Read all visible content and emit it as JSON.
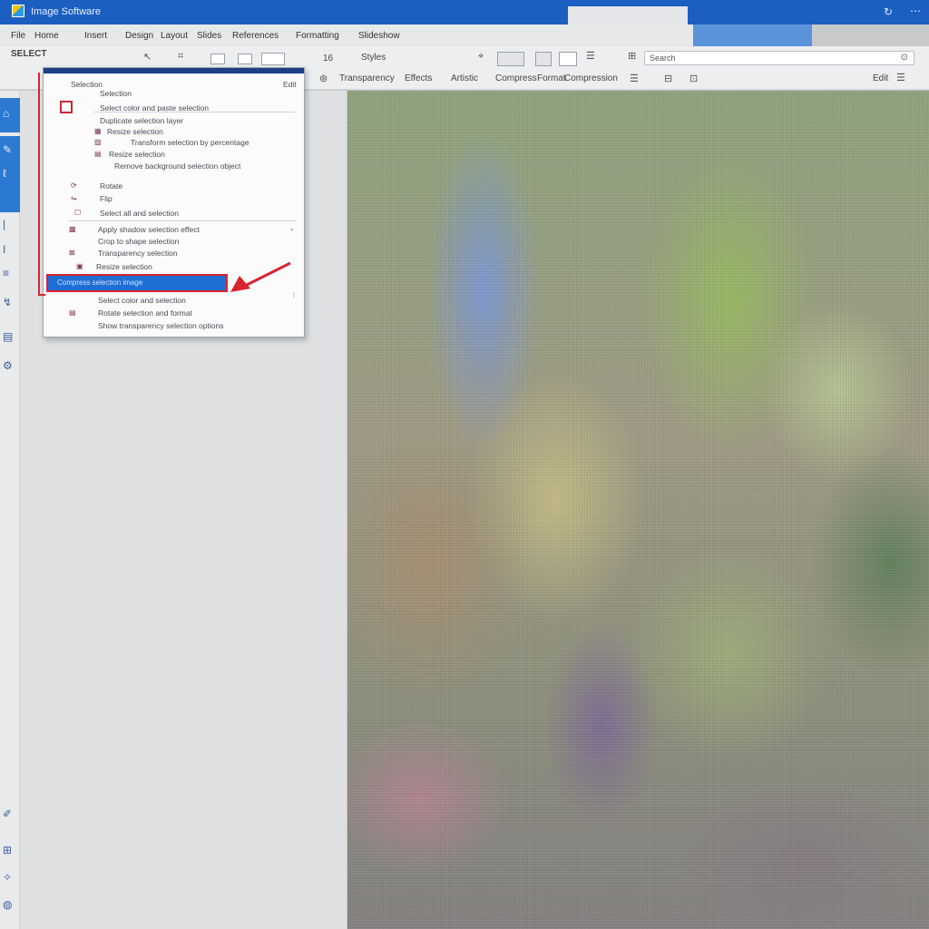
{
  "window": {
    "title": "Image Software",
    "help_icon": "help-icon",
    "more_icon": "more-icon"
  },
  "menubar": {
    "items": [
      "File",
      "Home",
      "Insert",
      "Design",
      "Layout",
      "Slides",
      "References",
      "Formatting",
      "Slideshow",
      "Slideshow"
    ]
  },
  "toolbar": {
    "row1_left": "SELECT",
    "font_size": "16",
    "style_label": "Styles",
    "search_placeholder": "Search",
    "row2_items": [
      "Transparency",
      "Effects",
      "Artistic",
      "Compress",
      "Format",
      "Compression"
    ],
    "row2_right": "Edit"
  },
  "dropdown": {
    "header_left": "Selection",
    "header_right": "Edit",
    "items": [
      "Selection",
      "Select color and paste selection",
      "Duplicate selection layer",
      "Resize selection",
      "Transform selection by percentage",
      "Resize selection",
      "Remove background selection object",
      "Rotate",
      "Flip",
      "Select all and selection",
      "Apply shadow selection effect",
      "Crop to shape selection",
      "Transparency selection",
      "Resize selection",
      "Select color and selection",
      "Rotate selection and format",
      "Show transparency selection options"
    ],
    "highlighted": "Compress selection image"
  }
}
